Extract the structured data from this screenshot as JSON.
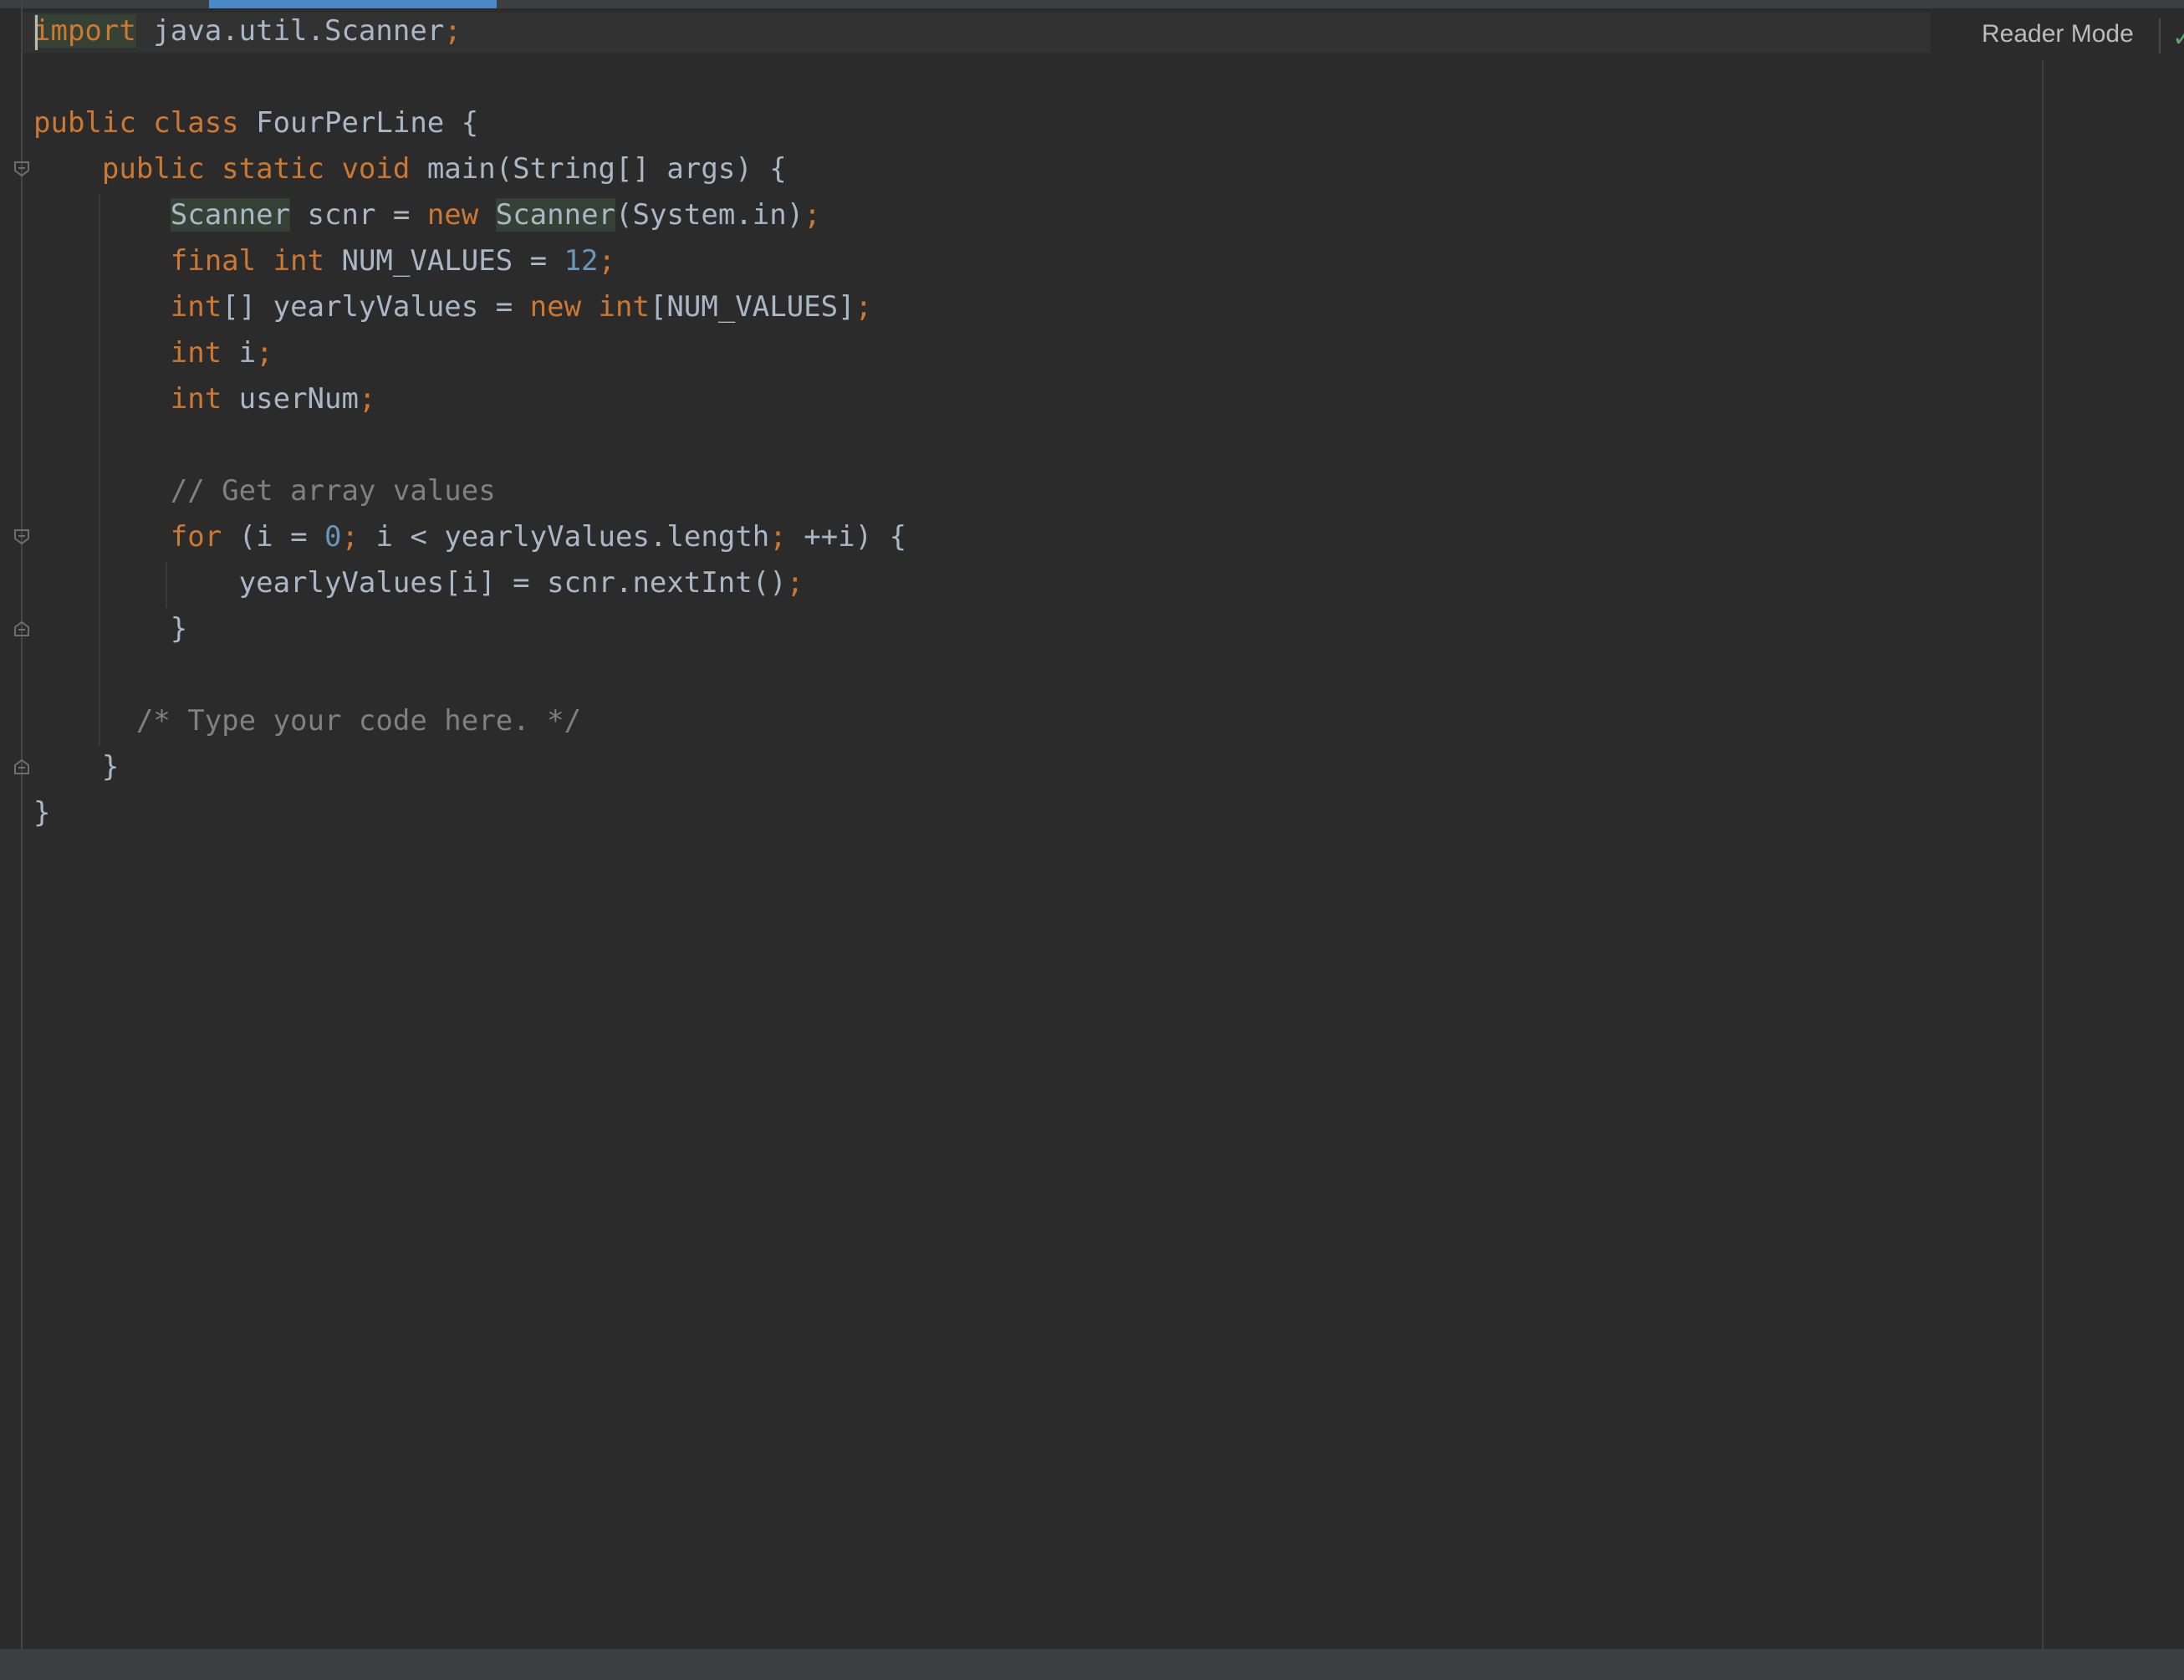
{
  "toolbar": {
    "reader_mode": "Reader Mode"
  },
  "editor": {
    "lines": [
      [
        "import",
        " java.util.Scanner",
        ";"
      ],
      [],
      [
        "public class",
        " FourPerLine {"
      ],
      [
        "    ",
        "public static void",
        " main(String[] args) {"
      ],
      [
        "        ",
        "Scanner",
        " scnr = ",
        "new",
        " ",
        "Scanner",
        "(System.in)",
        ";"
      ],
      [
        "        ",
        "final int",
        " NUM_VALUES = ",
        "12",
        ";"
      ],
      [
        "        ",
        "int",
        "[] yearlyValues = ",
        "new int",
        "[NUM_VALUES]",
        ";"
      ],
      [
        "        ",
        "int",
        " i",
        ";"
      ],
      [
        "        ",
        "int",
        " userNum",
        ";"
      ],
      [],
      [
        "        ",
        "// Get array values"
      ],
      [
        "        ",
        "for",
        " (i = ",
        "0",
        "; ",
        "i < yearlyValues.length",
        "; ",
        "++i) {"
      ],
      [
        "            yearlyValues[i] = scnr.nextInt()",
        ";"
      ],
      [
        "        }"
      ],
      [],
      [
        "      ",
        "/* Type your code here. */"
      ],
      [
        "    }"
      ],
      [
        "}"
      ]
    ]
  },
  "colors": {
    "background": "#2b2b2b",
    "keyword": "#cc7832",
    "text": "#a9b7c6",
    "number": "#6897bb",
    "comment": "#808080",
    "accent": "#4a88c7"
  }
}
